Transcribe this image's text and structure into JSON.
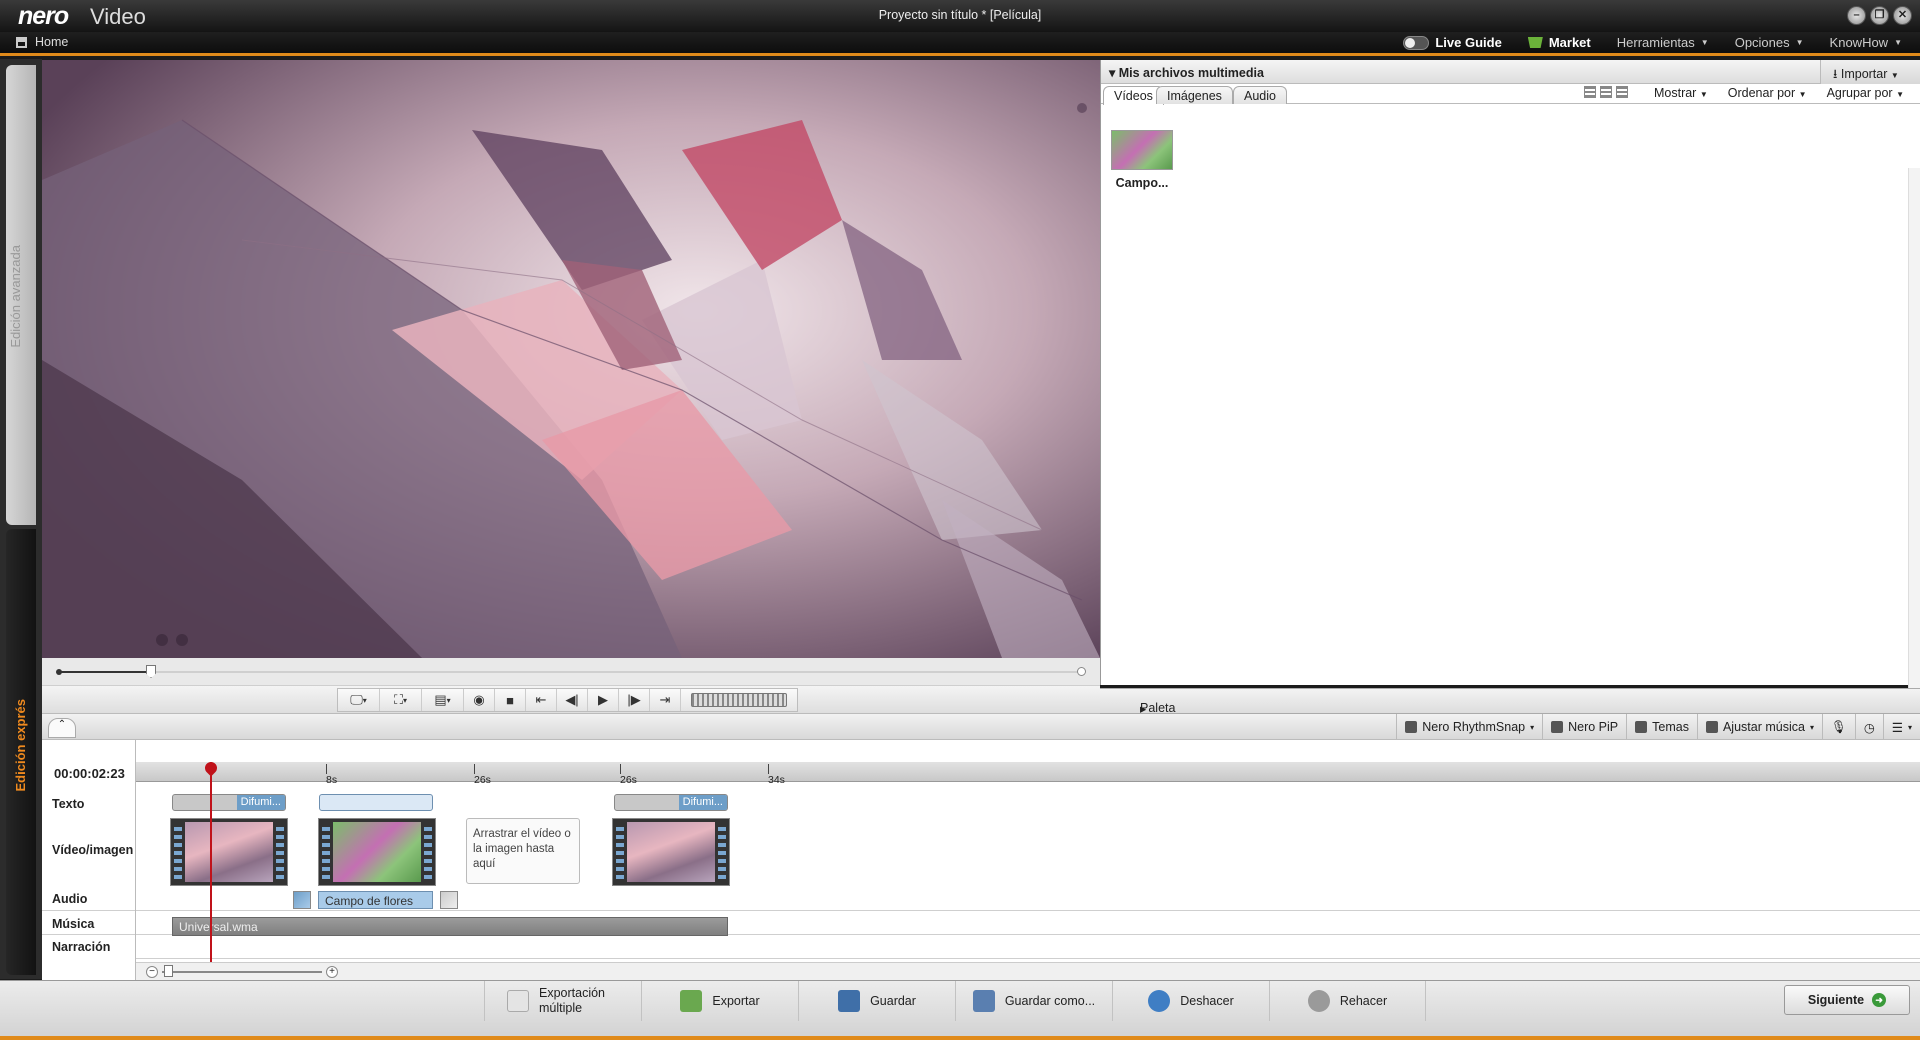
{
  "app": {
    "logo_brand": "nero",
    "logo_product": "Video",
    "window_title": "Proyecto sin título * [Película]"
  },
  "menu": {
    "home": "Home",
    "live_guide": "Live Guide",
    "market": "Market",
    "herramientas": "Herramientas",
    "opciones": "Opciones",
    "knowhow": "KnowHow"
  },
  "side_tabs": {
    "advanced": "Edición avanzada",
    "express": "Edición exprés"
  },
  "media_panel": {
    "title": "Mis archivos multimedia",
    "import": "Importar",
    "tabs": [
      "Vídeos",
      "Imágenes",
      "Audio"
    ],
    "active_tab": "Vídeos",
    "mostrar": "Mostrar",
    "ordenar": "Ordenar por",
    "agrupar": "Agrupar por",
    "items": [
      {
        "caption": "Campo..."
      }
    ]
  },
  "effects_palette": "Paleta de efectos:",
  "timeline_tools": [
    "Nero RhythmSnap",
    "Nero PiP",
    "Temas",
    "Ajustar música"
  ],
  "timeline": {
    "timecode": "00:00:02:23",
    "ruler_ticks": [
      "8s",
      "26s",
      "26s",
      "34s"
    ],
    "tracks": [
      "Texto",
      "Vídeo/imagen",
      "Audio",
      "Música",
      "Narración"
    ],
    "text_clips": [
      "Difumi...",
      "",
      "Difumi..."
    ],
    "drop_hint": "Arrastrar el vídeo o la imagen hasta aquí",
    "audio_clip": "Campo de flores",
    "music_clip": "Universal.wma"
  },
  "footer": {
    "export_multi": "Exportación múltiple",
    "export": "Exportar",
    "save": "Guardar",
    "save_as": "Guardar como...",
    "undo": "Deshacer",
    "redo": "Rehacer",
    "next": "Siguiente"
  },
  "colors": {
    "accent": "#e08a1a",
    "express_tab": "#f08a1e",
    "playhead": "#c0121a",
    "clip_label": "#6d9ec8"
  }
}
